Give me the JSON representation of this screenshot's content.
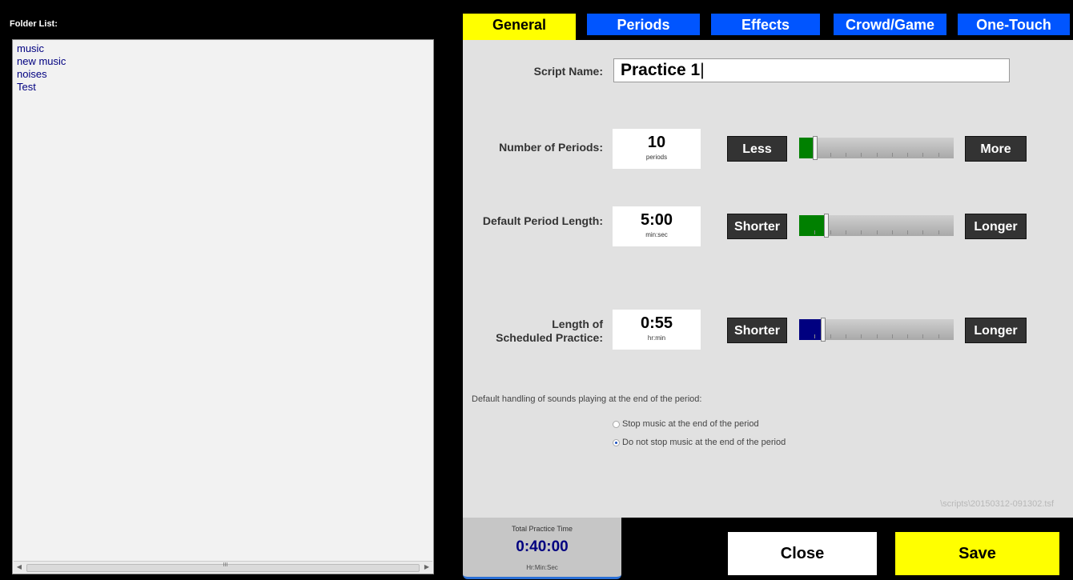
{
  "folder_panel": {
    "title": "Folder List:",
    "items": [
      "music",
      "new music",
      "noises",
      "Test"
    ],
    "scroll_grip": "III"
  },
  "tabs": [
    {
      "label": "General",
      "active": true
    },
    {
      "label": "Periods",
      "active": false
    },
    {
      "label": "Effects",
      "active": false
    },
    {
      "label": "Crowd/Game",
      "active": false
    },
    {
      "label": "One-Touch",
      "active": false
    }
  ],
  "general": {
    "script_name_label": "Script Name:",
    "script_name_value": "Practice 1",
    "num_periods": {
      "label": "Number of Periods:",
      "value": "10",
      "unit": "periods",
      "less_label": "Less",
      "more_label": "More",
      "slider_fraction": 0.09,
      "fill_color": "#008000"
    },
    "period_length": {
      "label": "Default Period Length:",
      "value": "5:00",
      "unit": "min:sec",
      "shorter_label": "Shorter",
      "longer_label": "Longer",
      "slider_fraction": 0.16,
      "fill_color": "#008000"
    },
    "scheduled": {
      "label_line1": "Length of",
      "label_line2": "Scheduled Practice:",
      "value": "0:55",
      "unit": "hr:min",
      "shorter_label": "Shorter",
      "longer_label": "Longer",
      "slider_fraction": 0.14,
      "fill_color": "#000080"
    },
    "sound_handling_label": "Default handling of sounds playing at the end of the period:",
    "radio_options": [
      {
        "label": "Stop music at the end of the period",
        "selected": false
      },
      {
        "label": "Do not stop music at the end of the period",
        "selected": true
      }
    ],
    "file_path": "\\scripts\\20150312-091302.tsf"
  },
  "total": {
    "label": "Total Practice Time",
    "value": "0:40:00",
    "unit": "Hr:Min:Sec"
  },
  "buttons": {
    "close_label": "Close",
    "save_label": "Save"
  }
}
